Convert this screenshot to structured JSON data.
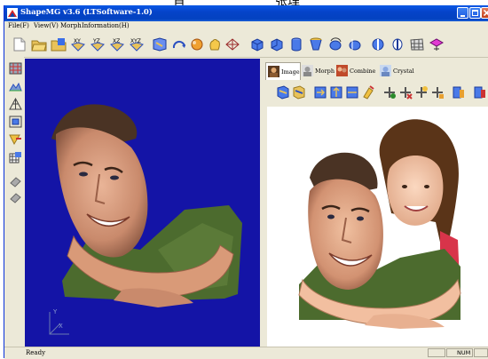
{
  "caption": {
    "left": "肖",
    "right": "张理"
  },
  "window": {
    "title": "ShapeMG v3.6 (LTSoftware-1.0)"
  },
  "menu": {
    "items": [
      "File(F)",
      "View(V)",
      "Morph",
      "Information(H)"
    ]
  },
  "toolbar": {
    "icons": [
      "new-icon",
      "open-icon",
      "open-mesh-icon",
      "xy-view-icon",
      "yz-view-icon",
      "xz-view-icon",
      "xyz-view-icon",
      "fit-view-icon",
      "rotate-icon",
      "sphere-icon",
      "pan-icon",
      "mesh-icon",
      "box-left-icon",
      "box-right-icon",
      "cylinder-icon",
      "cylinder2-icon",
      "rotate-x-icon",
      "rotate-y-icon",
      "light-icon",
      "light2-icon",
      "grid-icon",
      "morph-tool-icon"
    ]
  },
  "left_toolbar": {
    "icons": [
      "texture-icon",
      "terrain-icon",
      "wireframe-icon",
      "bbox-icon",
      "select-icon",
      "grid-select-icon",
      "pointer-icon",
      "pointer2-icon"
    ]
  },
  "viewport": {
    "axis_y": "Y",
    "axis_x": "X"
  },
  "tabs": [
    {
      "label": "Image"
    },
    {
      "label": "Morph"
    },
    {
      "label": "Combine"
    },
    {
      "label": "Crystal"
    }
  ],
  "image_tools": {
    "icons": [
      "load-image-icon",
      "save-image-icon",
      "rotate-image-icon",
      "flip-image-icon",
      "mirror-image-icon",
      "paint-icon",
      "add-point-icon",
      "remove-point-icon",
      "move-point-icon",
      "clear-points-icon",
      "export-icon",
      "import-icon"
    ]
  },
  "status": {
    "text": "Ready",
    "num": "NUM"
  },
  "colors": {
    "titlebar": "#0543c9",
    "viewport_bg": "#1414a6",
    "chrome": "#ece9d8"
  }
}
